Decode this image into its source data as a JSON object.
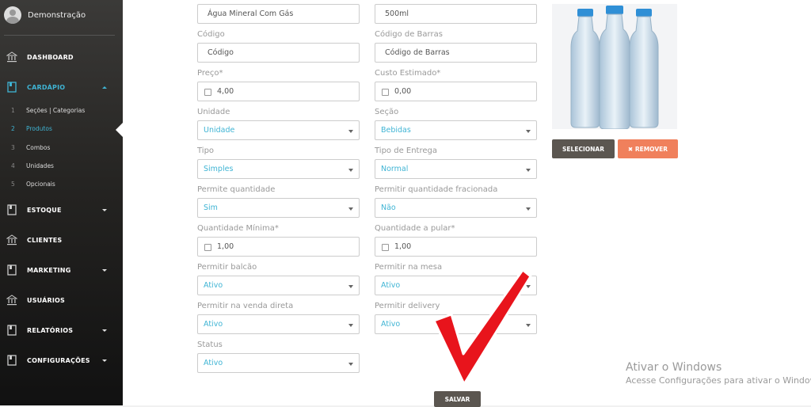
{
  "sidebar": {
    "user_name": "Demonstração",
    "items": [
      {
        "label": "DASHBOARD",
        "icon": "bank-icon"
      },
      {
        "label": "CARDÁPIO",
        "icon": "book-icon"
      },
      {
        "label": "ESTOQUE",
        "icon": "book-icon"
      },
      {
        "label": "CLIENTES",
        "icon": "bank-icon"
      },
      {
        "label": "MARKETING",
        "icon": "book-icon"
      },
      {
        "label": "USUÁRIOS",
        "icon": "bank-icon"
      },
      {
        "label": "RELATÓRIOS",
        "icon": "book-icon"
      },
      {
        "label": "CONFIGURAÇÕES",
        "icon": "book-icon"
      }
    ],
    "submenu": [
      {
        "num": "1",
        "label": "Seções | Categorias"
      },
      {
        "num": "2",
        "label": "Produtos"
      },
      {
        "num": "3",
        "label": "Combos"
      },
      {
        "num": "4",
        "label": "Unidades"
      },
      {
        "num": "5",
        "label": "Opcionais"
      }
    ]
  },
  "form": {
    "nome": {
      "value": "Água Mineral Com Gás"
    },
    "volume": {
      "value": "500ml"
    },
    "codigo": {
      "label": "Código",
      "placeholder": "Código"
    },
    "codigo_barras": {
      "label": "Código de Barras",
      "placeholder": "Código de Barras"
    },
    "preco": {
      "label": "Preço*",
      "value": "4,00"
    },
    "custo": {
      "label": "Custo Estimado*",
      "value": "0,00"
    },
    "unidade": {
      "label": "Unidade",
      "value": "Unidade"
    },
    "secao": {
      "label": "Seção",
      "value": "Bebidas"
    },
    "tipo": {
      "label": "Tipo",
      "value": "Simples"
    },
    "tipo_entrega": {
      "label": "Tipo de Entrega",
      "value": "Normal"
    },
    "permite_qtd": {
      "label": "Permite quantidade",
      "value": "Sim"
    },
    "permitir_frac": {
      "label": "Permitir quantidade fracionada",
      "value": "Não"
    },
    "qtd_minima": {
      "label": "Quantidade Mínima*",
      "value": "1,00"
    },
    "qtd_pular": {
      "label": "Quantidade a pular*",
      "value": "1,00"
    },
    "balcao": {
      "label": "Permitir balcão",
      "value": "Ativo"
    },
    "mesa": {
      "label": "Permitir na mesa",
      "value": "Ativo"
    },
    "venda_direta": {
      "label": "Permitir na venda direta",
      "value": "Ativo"
    },
    "delivery": {
      "label": "Permitir delivery",
      "value": "Ativo"
    },
    "status": {
      "label": "Status",
      "value": "Ativo"
    }
  },
  "image": {
    "select_label": "SELECIONAR",
    "remove_label": "✖ REMOVER"
  },
  "save_label": "SALVAR",
  "watermark": {
    "line1": "Ativar o Windows",
    "line2": "Acesse Configurações para ativar o Windows."
  },
  "colors": {
    "accent": "#3fb4d4",
    "remove": "#f0805c",
    "dark_button": "#5b5650",
    "annotation": "#e8141c"
  }
}
